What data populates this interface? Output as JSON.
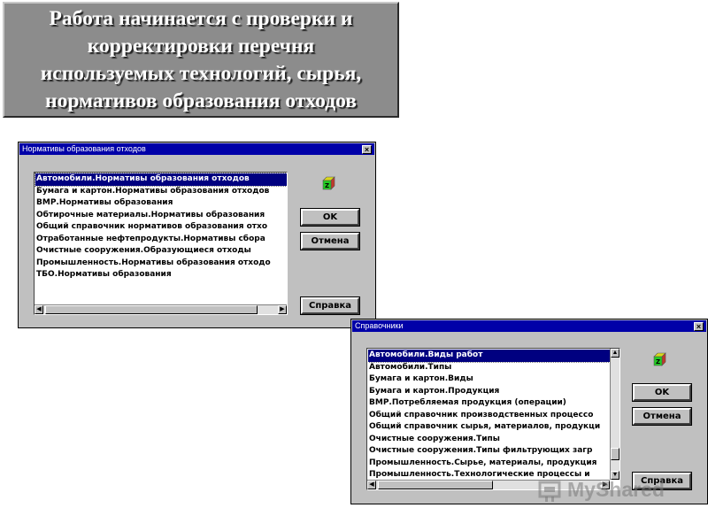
{
  "banner": {
    "lines": [
      "Работа начинается с проверки и",
      "корректировки перечня",
      "используемых технологий, сырья,",
      "нормативов образования отходов"
    ]
  },
  "dialog1": {
    "title": "Нормативы образования отходов",
    "close_label": "×",
    "items": [
      "Автомобили.Нормативы образования отходов",
      "Бумага и картон.Нормативы образования отходов",
      "ВМР.Нормативы образования",
      "Обтирочные материалы.Нормативы образования",
      "Общий справочник нормативов образования отхо",
      "Отработанные нефтепродукты.Нормативы сбора",
      "Очистные сооружения.Образующиеся отходы",
      "Промышленность.Нормативы образования отходо",
      "ТБО.Нормативы образования"
    ],
    "selected_index": 0,
    "ok_label": "OK",
    "cancel_label": "Отмена",
    "help_label": "Справка",
    "cube_letter": "Z"
  },
  "dialog2": {
    "title": "Справочники",
    "close_label": "×",
    "items": [
      "Автомобили.Виды работ",
      "Автомобили.Типы",
      "Бумага и картон.Виды",
      "Бумага и картон.Продукция",
      "ВМР.Потребляемая продукция (операции)",
      "Общий справочник производственных процессо",
      "Общий справочник сырья, материалов, продукци",
      "Очистные сооружения.Типы",
      "Очистные сооружения.Типы фильтрующих загр",
      "Промышленность.Сырье, материалы, продукция",
      "Промышленность.Технологические процессы и"
    ],
    "selected_index": 0,
    "ok_label": "OK",
    "cancel_label": "Отмена",
    "help_label": "Справка",
    "cube_letter": "Z"
  },
  "watermark": {
    "text": "MyShared",
    "icon": "myshared-logo-icon"
  },
  "colors": {
    "titlebar": "#0000a8",
    "selection": "#000080",
    "dialog_bg": "#c0c0c0",
    "banner_bg": "#8c8c8c",
    "cube_green": "#22cc22"
  }
}
